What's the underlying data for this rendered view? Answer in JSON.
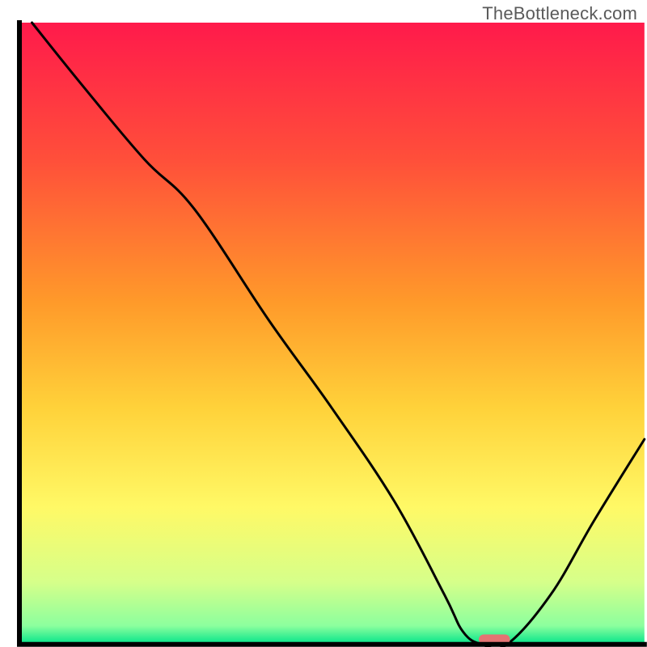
{
  "watermark": "TheBottleneck.com",
  "chart_data": {
    "type": "line",
    "title": "",
    "xlabel": "",
    "ylabel": "",
    "xlim": [
      0,
      100
    ],
    "ylim": [
      0,
      100
    ],
    "x": [
      2,
      10,
      20,
      28,
      40,
      50,
      60,
      68,
      71,
      74,
      78,
      85,
      92,
      100
    ],
    "y": [
      100,
      90,
      78,
      70,
      52,
      38,
      23,
      8,
      2,
      0,
      0,
      8,
      20,
      33
    ],
    "marker": {
      "x": 76,
      "y": 0,
      "width": 5,
      "height": 1.6,
      "color": "#e57373"
    },
    "gradient_stops": [
      {
        "offset": 0.0,
        "color": "#ff1a4b"
      },
      {
        "offset": 0.22,
        "color": "#ff4f3a"
      },
      {
        "offset": 0.45,
        "color": "#ff9a2a"
      },
      {
        "offset": 0.62,
        "color": "#ffd23a"
      },
      {
        "offset": 0.78,
        "color": "#fff966"
      },
      {
        "offset": 0.9,
        "color": "#d6ff8a"
      },
      {
        "offset": 0.97,
        "color": "#8cff9e"
      },
      {
        "offset": 1.0,
        "color": "#00e48a"
      }
    ],
    "axes": {
      "left_x": 3.0,
      "right_x": 99.6,
      "bottom_y": 99.6,
      "top_y": 3.5
    }
  }
}
